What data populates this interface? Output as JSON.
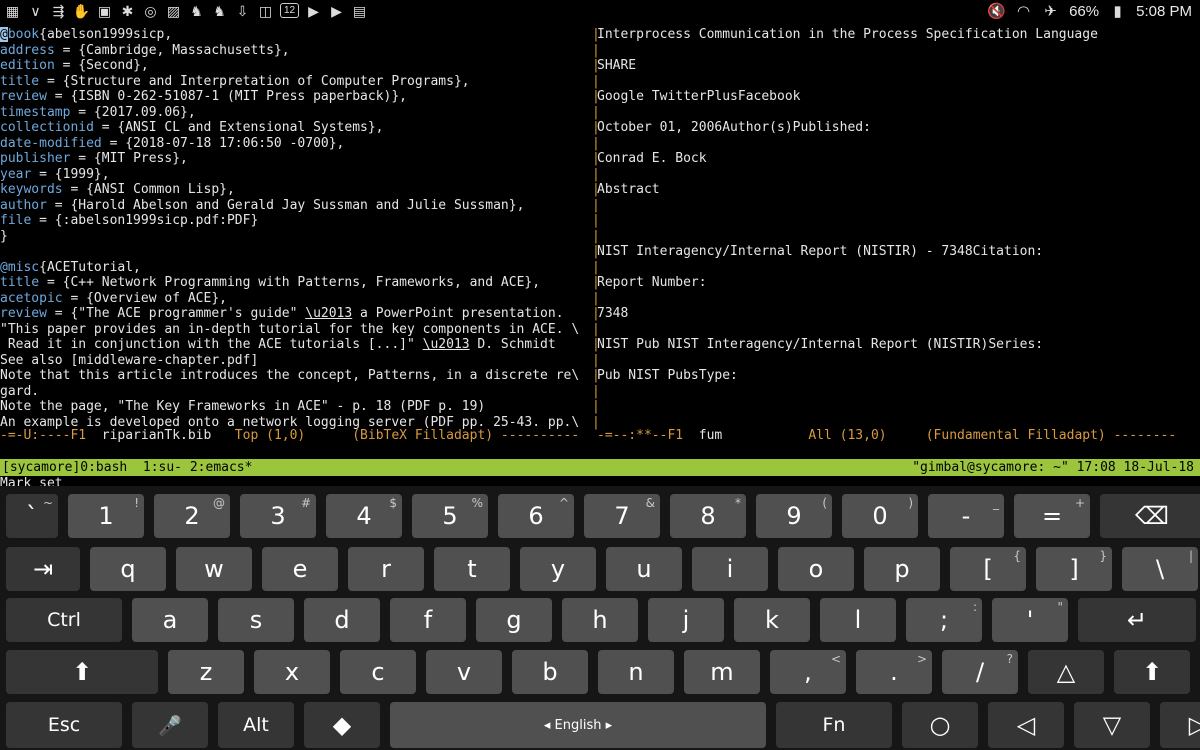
{
  "status_bar": {
    "left_icons": [
      "app-grid-icon",
      "chevron-down-icon",
      "usb-icon",
      "hand-icon",
      "photo-icon",
      "pinwheel-icon",
      "planet-icon",
      "image-icon",
      "evernote-icon",
      "evernote-icon",
      "download-icon",
      "bag-icon",
      "calendar-icon",
      "play-icon",
      "play-icon",
      "download-box-icon"
    ],
    "calendar_number": "12",
    "battery": "66%",
    "time": "5:08 PM"
  },
  "left_pane": {
    "lines": [
      [
        [
          "@",
          "cur"
        ],
        [
          "book",
          "kw"
        ],
        [
          "{abelson1999sicp,",
          ""
        ]
      ],
      [
        [
          "address",
          "kw"
        ],
        [
          " = {Cambridge, Massachusetts},",
          ""
        ]
      ],
      [
        [
          "edition",
          "kw"
        ],
        [
          " = {Second},",
          ""
        ]
      ],
      [
        [
          "title",
          "kw"
        ],
        [
          " = {Structure and Interpretation of Computer Programs},",
          ""
        ]
      ],
      [
        [
          "review",
          "kw"
        ],
        [
          " = {ISBN 0-262-51087-1 (MIT Press paperback)},",
          ""
        ]
      ],
      [
        [
          "timestamp",
          "kw"
        ],
        [
          " = {2017.09.06},",
          ""
        ]
      ],
      [
        [
          "collectionid",
          "kw"
        ],
        [
          " = {ANSI CL and Extensional Systems},",
          ""
        ]
      ],
      [
        [
          "date-modified",
          "kw"
        ],
        [
          " = {2018-07-18 17:06:50 -0700},",
          ""
        ]
      ],
      [
        [
          "publisher",
          "kw"
        ],
        [
          " = {MIT Press},",
          ""
        ]
      ],
      [
        [
          "year",
          "kw"
        ],
        [
          " = {1999},",
          ""
        ]
      ],
      [
        [
          "keywords",
          "kw"
        ],
        [
          " = {ANSI Common Lisp},",
          ""
        ]
      ],
      [
        [
          "author",
          "kw"
        ],
        [
          " = {Harold Abelson and Gerald Jay Sussman and Julie Sussman},",
          ""
        ]
      ],
      [
        [
          "file",
          "kw"
        ],
        [
          " = {:abelson1999sicp.pdf:PDF}",
          ""
        ]
      ],
      [
        [
          "}",
          ""
        ]
      ],
      [
        [
          "",
          ""
        ]
      ],
      [
        [
          "@misc",
          "kw"
        ],
        [
          "{ACETutorial,",
          ""
        ]
      ],
      [
        [
          "title",
          "kw"
        ],
        [
          " = {C++ Network Programming with Patterns, Frameworks, and ACE},",
          ""
        ]
      ],
      [
        [
          "acetopic",
          "kw"
        ],
        [
          " = {Overview of ACE},",
          ""
        ]
      ],
      [
        [
          "review",
          "kw"
        ],
        [
          " = {\"The ACE programmer's guide\" ",
          ""
        ],
        [
          "\\u2013",
          "u"
        ],
        [
          " a PowerPoint presentation.",
          ""
        ]
      ],
      [
        [
          "\"This paper provides an in-depth tutorial for the key components in ACE. \\",
          ""
        ]
      ],
      [
        [
          " Read it in conjunction with the ACE tutorials [...]\" ",
          ""
        ],
        [
          "\\u2013",
          "u"
        ],
        [
          " D. Schmidt",
          ""
        ]
      ],
      [
        [
          "See also [middleware-chapter.pdf]",
          ""
        ]
      ],
      [
        [
          "Note that this article introduces the concept, Patterns, in a discrete re\\",
          ""
        ]
      ],
      [
        [
          "gard.",
          ""
        ]
      ],
      [
        [
          "Note the page, \"The Key Frameworks in ACE\" - p. 18 (PDF p. 19)",
          ""
        ]
      ],
      [
        [
          "An example is developed onto a network logging server (PDF pp. 25-43. pp.\\",
          ""
        ]
      ]
    ],
    "modeline": {
      "prefix": "-=-U:----F1  ",
      "buffer": "riparianTk.bib",
      "position": "   Top (1,0)      ",
      "mode": "(BibTeX Filladapt) ----------"
    }
  },
  "right_pane": {
    "lines": [
      "Interprocess Communication in the Process Specification Language",
      "",
      "SHARE",
      "",
      "Google TwitterPlusFacebook",
      "",
      "October 01, 2006Author(s)Published:",
      "",
      "Conrad E. Bock",
      "",
      "Abstract",
      "",
      "",
      "",
      "NIST Interagency/Internal Report (NISTIR) - 7348Citation:",
      "",
      "Report Number:",
      "",
      "7348",
      "",
      "NIST Pub NIST Interagency/Internal Report (NISTIR)Series:",
      "",
      "Pub NIST PubsType:",
      "",
      "",
      ""
    ],
    "modeline": {
      "prefix": "-=--:**--F1  ",
      "buffer": "fum",
      "position": "           All (13,0)     ",
      "mode": "(Fundamental Filladapt) --------"
    }
  },
  "tmux": {
    "left": "[sycamore]0:bash  1:su- 2:emacs*",
    "right": "\"gimbal@sycamore: ~\" 17:08 18-Jul-18"
  },
  "minibuffer": "Mark set",
  "keyboard": {
    "rows": [
      [
        [
          "`",
          "~"
        ],
        [
          "1",
          "!"
        ],
        [
          "2",
          "@"
        ],
        [
          "3",
          "#"
        ],
        [
          "4",
          "$"
        ],
        [
          "5",
          "%"
        ],
        [
          "6",
          "^"
        ],
        [
          "7",
          "&"
        ],
        [
          "8",
          "*"
        ],
        [
          "9",
          "("
        ],
        [
          "0",
          ")"
        ],
        [
          "-",
          "_"
        ],
        [
          "=",
          "+"
        ],
        [
          "⌫",
          ""
        ]
      ],
      [
        [
          "⇥",
          ""
        ],
        [
          "q",
          ""
        ],
        [
          "w",
          ""
        ],
        [
          "e",
          ""
        ],
        [
          "r",
          ""
        ],
        [
          "t",
          ""
        ],
        [
          "y",
          ""
        ],
        [
          "u",
          ""
        ],
        [
          "i",
          ""
        ],
        [
          "o",
          ""
        ],
        [
          "p",
          ""
        ],
        [
          "[",
          "{"
        ],
        [
          "]",
          "}"
        ],
        [
          "\\",
          "|"
        ]
      ],
      [
        [
          "Ctrl",
          ""
        ],
        [
          "a",
          ""
        ],
        [
          "s",
          ""
        ],
        [
          "d",
          ""
        ],
        [
          "f",
          ""
        ],
        [
          "g",
          ""
        ],
        [
          "h",
          ""
        ],
        [
          "j",
          ""
        ],
        [
          "k",
          ""
        ],
        [
          "l",
          ""
        ],
        [
          ";",
          ":"
        ],
        [
          "'",
          "\""
        ],
        [
          "↵",
          ""
        ]
      ],
      [
        [
          "⬆",
          ""
        ],
        [
          "z",
          ""
        ],
        [
          "x",
          ""
        ],
        [
          "c",
          ""
        ],
        [
          "v",
          ""
        ],
        [
          "b",
          ""
        ],
        [
          "n",
          ""
        ],
        [
          "m",
          ""
        ],
        [
          ",",
          "<"
        ],
        [
          ".",
          ">"
        ],
        [
          "/",
          "?"
        ],
        [
          "△",
          ""
        ],
        [
          "⬆",
          ""
        ]
      ],
      [
        [
          "Esc",
          ""
        ],
        [
          "🎤",
          ""
        ],
        [
          "Alt",
          ""
        ],
        [
          "◆",
          ""
        ],
        [
          "◂ English ▸",
          ""
        ],
        [
          "Fn",
          ""
        ],
        [
          "○",
          ""
        ],
        [
          "◁",
          ""
        ],
        [
          "▽",
          ""
        ],
        [
          "▷",
          ""
        ]
      ]
    ]
  }
}
